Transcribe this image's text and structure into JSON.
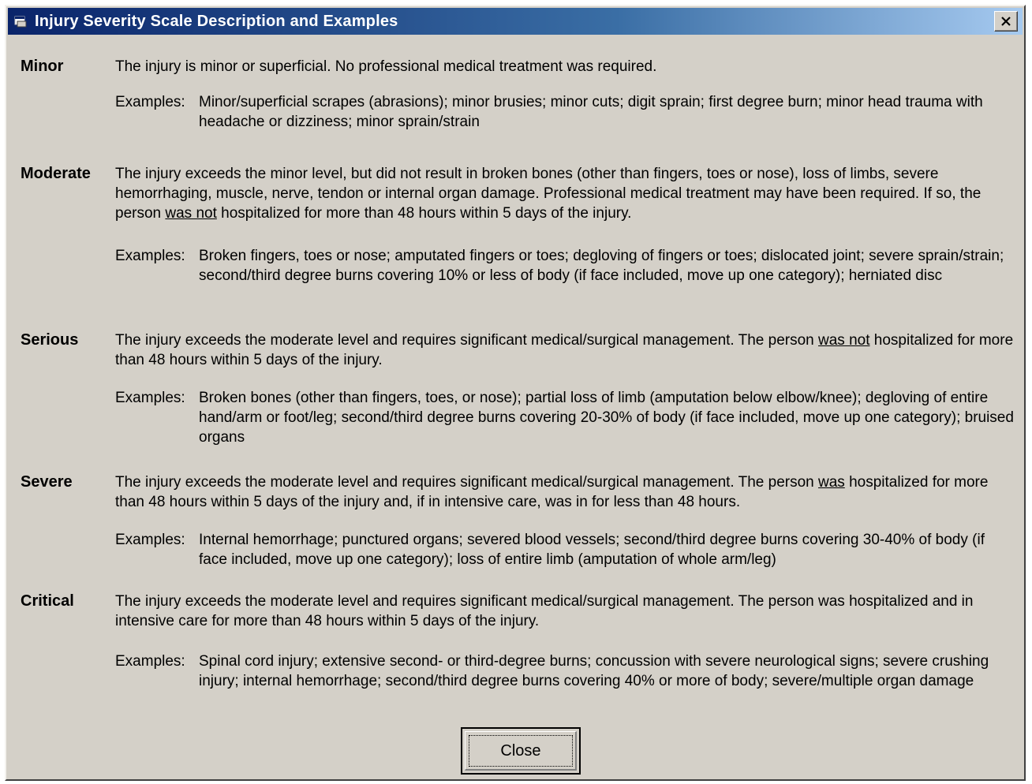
{
  "window": {
    "title": "Injury Severity Scale Description and Examples",
    "close_glyph": "X",
    "app_icon": "application-icon",
    "colors": {
      "face": "#d4d0c8",
      "titlebar_start": "#0a246a",
      "titlebar_end": "#a6caf0"
    }
  },
  "examples_label": "Examples:",
  "severities": {
    "minor": {
      "label": "Minor",
      "desc": "The injury is minor or superficial.  No professional medical treatment was required.",
      "examples": "Minor/superficial scrapes (abrasions); minor brusies; minor cuts; digit sprain; first degree burn; minor head trauma with headache or dizziness; minor sprain/strain"
    },
    "moderate": {
      "label": "Moderate",
      "desc_before": "The injury exceeds the minor level, but did not result in broken bones (other than fingers, toes or nose), loss of limbs, severe hemorrhaging, muscle, nerve, tendon or internal organ damage.  Professional medical treatment may have been required.  If so, the person ",
      "desc_underlined": "was not",
      "desc_after": " hospitalized for more than 48 hours within 5 days of the injury.",
      "examples": "Broken fingers, toes or nose; amputated fingers or toes; degloving of fingers or toes; dislocated joint; severe sprain/strain; second/third degree burns covering 10% or less of body (if face included, move up one category); herniated disc"
    },
    "serious": {
      "label": "Serious",
      "desc_before": "The injury exceeds the moderate level and requires significant medical/surgical management.  The person ",
      "desc_underlined": "was not",
      "desc_after": " hospitalized for more than 48 hours within 5 days of the injury.",
      "examples": "Broken bones (other than fingers, toes, or nose); partial loss of limb (amputation below elbow/knee); degloving of entire hand/arm or foot/leg; second/third degree burns covering 20-30% of body (if face included, move up one category); bruised organs"
    },
    "severe": {
      "label": "Severe",
      "desc_before": "The injury exceeds the moderate level and requires significant medical/surgical management.  The person ",
      "desc_underlined": "was",
      "desc_after": " hospitalized for more than 48 hours within 5 days of the injury and, if in intensive care, was in for less than 48 hours.",
      "examples": "Internal hemorrhage; punctured organs; severed blood vessels; second/third degree burns covering 30-40% of body (if face included, move up one category); loss of entire limb (amputation of whole arm/leg)"
    },
    "critical": {
      "label": "Critical",
      "desc": "The injury exceeds the moderate level and requires significant medical/surgical management.  The person was hospitalized and in intensive care for more than 48 hours within 5 days of the injury.",
      "examples": "Spinal cord injury; extensive second- or third-degree burns; concussion with severe neurological signs; severe crushing injury; internal hemorrhage; second/third degree burns covering 40% or more of body; severe/multiple organ damage"
    }
  },
  "buttons": {
    "close": "Close"
  }
}
